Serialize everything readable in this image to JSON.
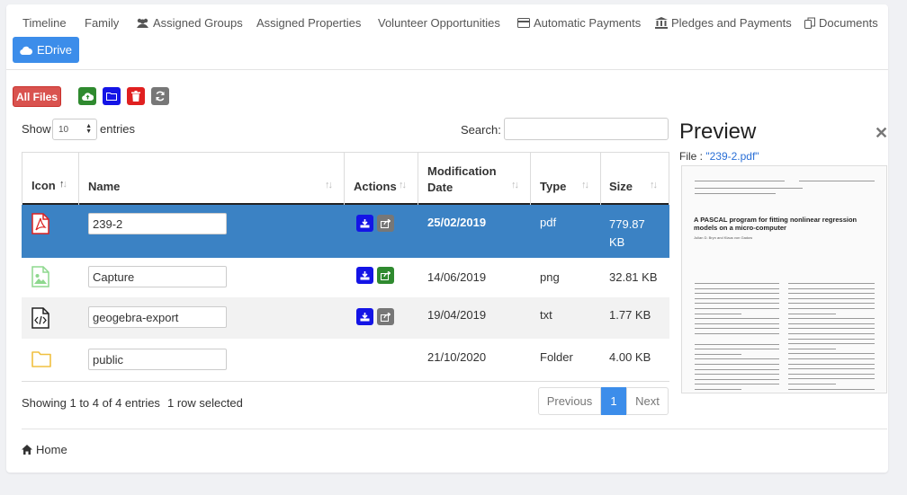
{
  "tabs": [
    {
      "label": "Timeline",
      "icon": ""
    },
    {
      "label": "Family",
      "icon": ""
    },
    {
      "label": "Assigned Groups",
      "icon": "users-icon"
    },
    {
      "label": "Assigned Properties",
      "icon": ""
    },
    {
      "label": "Volunteer Opportunities",
      "icon": ""
    },
    {
      "label": "Automatic Payments",
      "icon": "credit-card-icon"
    },
    {
      "label": "Pledges and Payments",
      "icon": "bank-icon"
    },
    {
      "label": "Documents",
      "icon": "copy-icon"
    },
    {
      "label": "EDrive",
      "icon": "cloud-icon",
      "active": true
    }
  ],
  "toolbar": {
    "all_files_label": "All Files",
    "upload_icon": "cloud-upload-icon",
    "folder_icon": "folder-icon",
    "delete_icon": "trash-icon",
    "refresh_icon": "refresh-icon"
  },
  "table_controls": {
    "show_label": "Show",
    "entries_value": "10",
    "entries_label": "entries",
    "search_label": "Search:",
    "search_value": ""
  },
  "table": {
    "headers": [
      "Icon",
      "Name",
      "Actions",
      "Modification Date",
      "Type",
      "Size"
    ],
    "rows": [
      {
        "icon": "pdf-file-icon",
        "name": "239-2",
        "date": "25/02/2019",
        "type": "pdf",
        "size": "779.87 KB",
        "selected": true
      },
      {
        "icon": "image-file-icon",
        "name": "Capture",
        "date": "14/06/2019",
        "type": "png",
        "size": "32.81 KB"
      },
      {
        "icon": "code-file-icon",
        "name": "geogebra-export",
        "date": "19/04/2019",
        "type": "txt",
        "size": "1.77 KB"
      },
      {
        "icon": "folder-icon",
        "name": "public",
        "date": "21/10/2020",
        "type": "Folder",
        "size": "4.00 KB"
      }
    ]
  },
  "footer": {
    "showing": "Showing 1 to 4 of 4 entries",
    "selected": "1 row selected",
    "pager": {
      "previous": "Previous",
      "current": "1",
      "next": "Next"
    },
    "breadcrumb_home": "Home"
  },
  "preview": {
    "title": "Preview",
    "file_label": "File : ",
    "file_name": "\"239-2.pdf\"",
    "doc_title": "A PASCAL program for fitting nonlinear regression models on a micro-computer",
    "doc_authors": "Julian D. Bryn and Klaus von Gadow"
  },
  "colors": {
    "primary": "#3c8dea",
    "selected_row": "#3b82c4",
    "danger": "#d9534f",
    "success": "#2f8a2f",
    "blue_btn": "#1414e6",
    "grey_btn": "#777777",
    "link": "#2a6fd6"
  }
}
